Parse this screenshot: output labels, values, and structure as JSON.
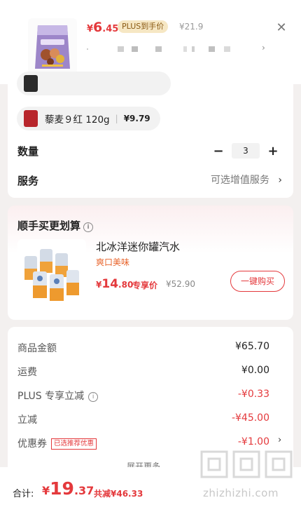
{
  "header": {
    "price_currency": "¥",
    "price_int": "6",
    "price_dec": ".45",
    "plus_badge": "PLUS到手价",
    "original_price": "¥21.9",
    "close_icon": "close-icon"
  },
  "spec_options": [
    {
      "label": "藜麦９红 120g",
      "price": "¥9.79",
      "icon": "product-swatch-icon"
    }
  ],
  "quantity": {
    "label": "数量",
    "value": "3",
    "minus": "−",
    "plus": "+"
  },
  "service": {
    "label": "服务",
    "value": "可选增值服务",
    "chevron": "›"
  },
  "addon": {
    "title": "顺手买更划算",
    "info_icon": "i",
    "product_name": "北冰洋迷你罐汽水",
    "tag": "爽口美味",
    "price_currency": "¥",
    "price_int": "14",
    "price_dec": ".80",
    "exclusive_label": "专享价",
    "original_price": "¥52.90",
    "buy_button": "一键购买"
  },
  "summary": {
    "rows": [
      {
        "label": "商品金额",
        "value": "¥65.70"
      },
      {
        "label": "运费",
        "value": "¥0.00"
      },
      {
        "label": "PLUS 专享立减",
        "value": "-¥0.33"
      },
      {
        "label": "立减",
        "value": "-¥45.00"
      },
      {
        "label": "优惠券",
        "value": "-¥1.00",
        "badge": "已选推荐优惠"
      }
    ],
    "expand": "展开更多",
    "expand_chevron": "⌄"
  },
  "footer": {
    "total_label": "合计:",
    "total_currency": "¥",
    "total_int": "19",
    "total_dec": ".37",
    "saved": "共减¥46.33"
  },
  "watermark": "zhizhizhi.com",
  "colors": {
    "accent": "#e4393c",
    "plus_gold": "#f6e7c4",
    "tag_orange": "#e8632a"
  }
}
